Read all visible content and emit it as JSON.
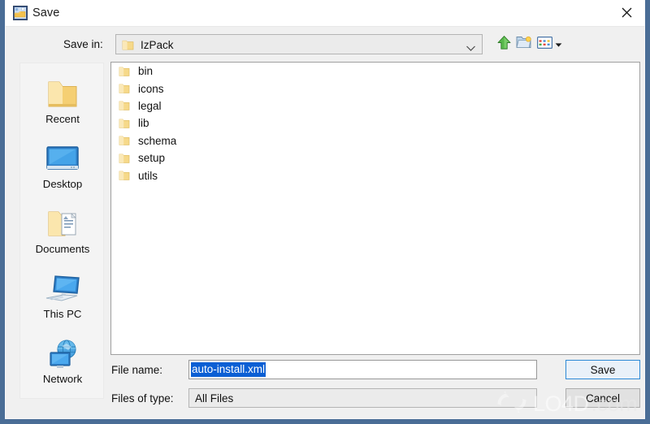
{
  "window": {
    "title": "Save",
    "title_icon": "save-dialog-icon",
    "close_icon": "close-icon",
    "border_color": "#4a6d96"
  },
  "toolbar": {
    "save_in_label": "Save in:",
    "current_folder": "IzPack",
    "folder_icon": "folder-icon",
    "dropdown_icon": "chevron-down-icon",
    "buttons": [
      {
        "name": "up-one-level-button",
        "icon": "up-arrow-icon",
        "label": ""
      },
      {
        "name": "new-folder-button",
        "icon": "new-folder-icon",
        "label": ""
      },
      {
        "name": "view-menu-button",
        "icon": "view-list-icon",
        "label": ""
      }
    ]
  },
  "places": {
    "items": [
      {
        "label": "Recent",
        "icon": "folder-icon"
      },
      {
        "label": "Desktop",
        "icon": "monitor-icon"
      },
      {
        "label": "Documents",
        "icon": "documents-folder-icon"
      },
      {
        "label": "This PC",
        "icon": "computer-icon"
      },
      {
        "label": "Network",
        "icon": "network-globe-icon"
      }
    ]
  },
  "file_list": {
    "entries": [
      {
        "name": "bin",
        "type": "folder",
        "icon": "folder-icon"
      },
      {
        "name": "icons",
        "type": "folder",
        "icon": "folder-icon"
      },
      {
        "name": "legal",
        "type": "folder",
        "icon": "folder-icon"
      },
      {
        "name": "lib",
        "type": "folder",
        "icon": "folder-icon"
      },
      {
        "name": "schema",
        "type": "folder",
        "icon": "folder-icon"
      },
      {
        "name": "setup",
        "type": "folder",
        "icon": "folder-icon"
      },
      {
        "name": "utils",
        "type": "folder",
        "icon": "folder-icon"
      }
    ]
  },
  "form": {
    "file_name_label": "File name:",
    "file_name_value": "auto-install.xml",
    "file_name_placeholder": "",
    "file_name_selected": true,
    "files_of_type_label": "Files of type:",
    "files_of_type_value": "All Files"
  },
  "buttons": {
    "save_label": "Save",
    "cancel_label": "Cancel",
    "focus_color": "#2d8ad6"
  },
  "watermark": {
    "brand": "LO4D",
    "suffix": ".com",
    "icon": "recycle-arrows-icon"
  }
}
